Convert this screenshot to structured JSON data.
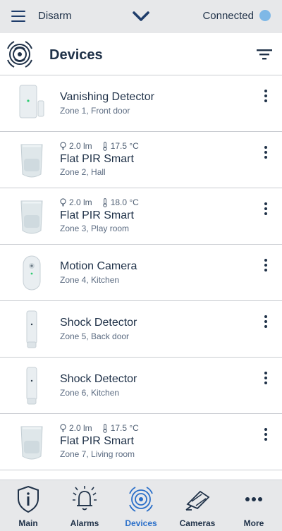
{
  "topbar": {
    "menu_icon": "hamburger-icon",
    "status_label": "Disarm",
    "chevron_icon": "chevron-down-icon",
    "connection_label": "Connected",
    "connection_color": "#7fb8e6"
  },
  "header": {
    "logo_icon": "signal-waves-logo",
    "title": "Devices",
    "filter_icon": "filter-icon"
  },
  "devices": [
    {
      "type": "door-contact",
      "name": "Vanishing Detector",
      "zone": "Zone 1, Front door",
      "light": "",
      "temp": ""
    },
    {
      "type": "pir",
      "name": "Flat PIR Smart",
      "zone": "Zone 2, Hall",
      "light": "2.0 lm",
      "temp": "17.5 °C"
    },
    {
      "type": "pir",
      "name": "Flat PIR Smart",
      "zone": "Zone 3, Play room",
      "light": "2.0 lm",
      "temp": "18.0 °C"
    },
    {
      "type": "camera",
      "name": "Motion Camera",
      "zone": "Zone 4, Kitchen",
      "light": "",
      "temp": ""
    },
    {
      "type": "shock",
      "name": "Shock Detector",
      "zone": "Zone 5, Back door",
      "light": "",
      "temp": ""
    },
    {
      "type": "shock",
      "name": "Shock Detector",
      "zone": "Zone 6, Kitchen",
      "light": "",
      "temp": ""
    },
    {
      "type": "pir",
      "name": "Flat PIR Smart",
      "zone": "Zone 7, Living room",
      "light": "2.0 lm",
      "temp": "17.5 °C"
    }
  ],
  "nav": [
    {
      "label": "Main",
      "icon": "shield-info-icon",
      "active": false
    },
    {
      "label": "Alarms",
      "icon": "bell-icon",
      "active": false
    },
    {
      "label": "Devices",
      "icon": "signal-waves-icon",
      "active": true
    },
    {
      "label": "Cameras",
      "icon": "camera-icon",
      "active": false
    },
    {
      "label": "More",
      "icon": "more-dots-icon",
      "active": false
    }
  ],
  "colors": {
    "text": "#1f3148",
    "accent": "#2a6fc9",
    "bar_bg": "#e7e8ea"
  }
}
